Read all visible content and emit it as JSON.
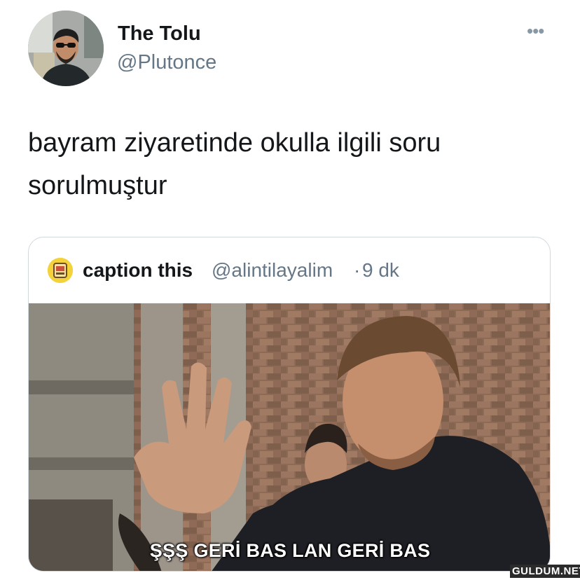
{
  "author": {
    "display_name": "The Tolu",
    "handle": "@Plutonce"
  },
  "more_menu": {
    "label": "•••"
  },
  "tweet": {
    "line1": "bayram ziyaretinde okulla ilgili soru",
    "line2": "sorulmuştur"
  },
  "quoted_tweet": {
    "display_name": "caption this",
    "handle": "@alintilayalim",
    "separator": "·",
    "time": "9 dk",
    "media_subtitle": "ŞŞŞ GERİ BAS LAN  GERİ BAS"
  },
  "watermark": {
    "text": "GULDUM.NET"
  },
  "colors": {
    "primary_text": "#14171a",
    "secondary_text": "#657786",
    "card_border": "#cfd9de"
  }
}
